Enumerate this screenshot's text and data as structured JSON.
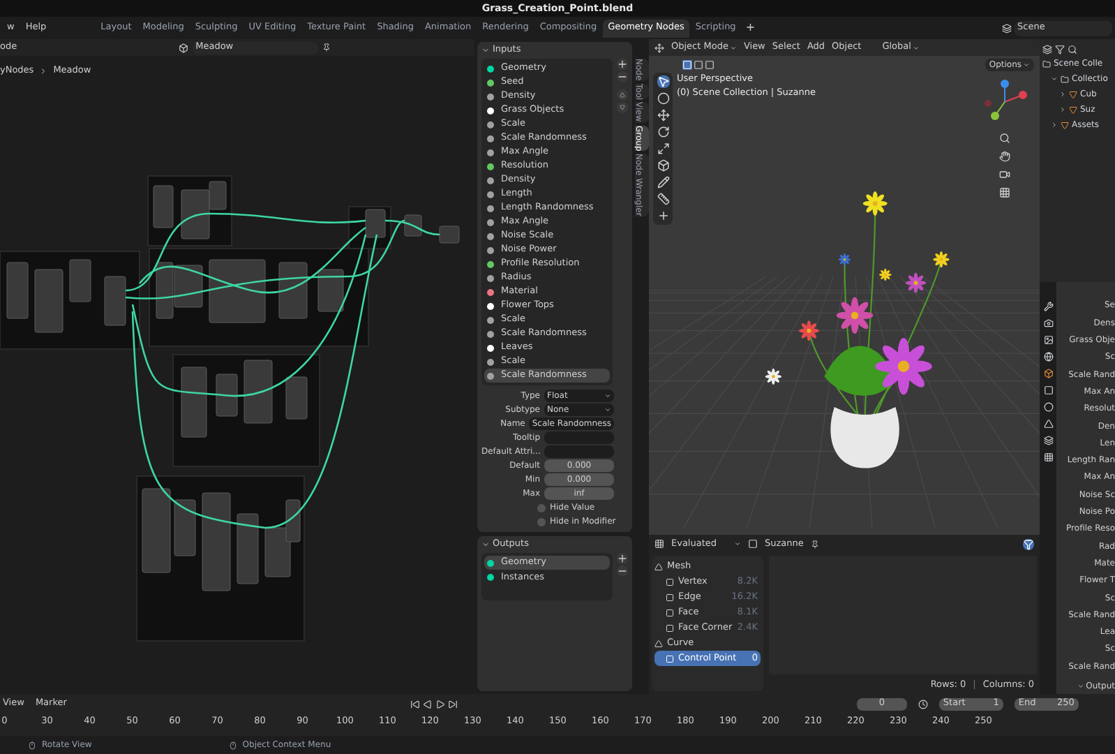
{
  "window": {
    "title": "Grass_Creation_Point.blend"
  },
  "menu": [
    "w",
    "Help"
  ],
  "workspace_tabs": [
    {
      "label": "Layout",
      "selected": false
    },
    {
      "label": "Modeling",
      "selected": false
    },
    {
      "label": "Sculpting",
      "selected": false
    },
    {
      "label": "UV Editing",
      "selected": false
    },
    {
      "label": "Texture Paint",
      "selected": false
    },
    {
      "label": "Shading",
      "selected": false
    },
    {
      "label": "Animation",
      "selected": false
    },
    {
      "label": "Rendering",
      "selected": false
    },
    {
      "label": "Compositing",
      "selected": false
    },
    {
      "label": "Geometry Nodes",
      "selected": true
    },
    {
      "label": "Scripting",
      "selected": false
    }
  ],
  "add_workspace": "+",
  "scene": {
    "value": "Scene"
  },
  "node_editor": {
    "editor_label": "ode",
    "node_group": "Meadow",
    "breadcrumb": [
      "yNodes",
      "Meadow"
    ]
  },
  "side_tabs": [
    {
      "label": "Node",
      "selected": false
    },
    {
      "label": "Tool",
      "selected": false
    },
    {
      "label": "View",
      "selected": false
    },
    {
      "label": "Group",
      "selected": true
    },
    {
      "label": "Node Wrangler",
      "selected": false
    }
  ],
  "group_inputs": {
    "title": "Inputs",
    "items": [
      {
        "name": "Geometry",
        "color": "#00d6a3",
        "selected": false
      },
      {
        "name": "Seed",
        "color": "#63c763",
        "selected": false
      },
      {
        "name": "Density",
        "color": "#a1a1a1",
        "selected": false
      },
      {
        "name": "Grass Objects",
        "color": "#ffffff",
        "selected": false
      },
      {
        "name": "Scale",
        "color": "#a1a1a1",
        "selected": false
      },
      {
        "name": "Scale Randomness",
        "color": "#a1a1a1",
        "selected": false
      },
      {
        "name": "Max Angle",
        "color": "#a1a1a1",
        "selected": false
      },
      {
        "name": "Resolution",
        "color": "#63c763",
        "selected": false
      },
      {
        "name": "Density",
        "color": "#a1a1a1",
        "selected": false
      },
      {
        "name": "Length",
        "color": "#a1a1a1",
        "selected": false
      },
      {
        "name": "Length Randomness",
        "color": "#a1a1a1",
        "selected": false
      },
      {
        "name": "Max Angle",
        "color": "#a1a1a1",
        "selected": false
      },
      {
        "name": "Noise Scale",
        "color": "#a1a1a1",
        "selected": false
      },
      {
        "name": "Noise Power",
        "color": "#a1a1a1",
        "selected": false
      },
      {
        "name": "Profile Resolution",
        "color": "#63c763",
        "selected": false
      },
      {
        "name": "Radius",
        "color": "#a1a1a1",
        "selected": false
      },
      {
        "name": "Material",
        "color": "#eb7582",
        "selected": false
      },
      {
        "name": "Flower Tops",
        "color": "#ffffff",
        "selected": false
      },
      {
        "name": "Scale",
        "color": "#a1a1a1",
        "selected": false
      },
      {
        "name": "Scale Randomness",
        "color": "#a1a1a1",
        "selected": false
      },
      {
        "name": "Leaves",
        "color": "#ffffff",
        "selected": false
      },
      {
        "name": "Scale",
        "color": "#a1a1a1",
        "selected": false
      },
      {
        "name": "Scale Randomness",
        "color": "#a1a1a1",
        "selected": true
      }
    ]
  },
  "socket_properties": [
    {
      "label": "Type",
      "value": "Float",
      "kind": "dropdown"
    },
    {
      "label": "Subtype",
      "value": "None",
      "kind": "dropdown"
    },
    {
      "label": "Name",
      "value": "Scale Randomness",
      "kind": "text"
    },
    {
      "label": "Tooltip",
      "kind": "text"
    },
    {
      "label": "Default Attri...",
      "kind": "text"
    },
    {
      "label": "Default",
      "value": "0.000",
      "kind": "number"
    },
    {
      "label": "Min",
      "value": "0.000",
      "kind": "number"
    },
    {
      "label": "Max",
      "value": "inf",
      "kind": "number"
    }
  ],
  "options": [
    {
      "label": "Hide Value",
      "checked": false
    },
    {
      "label": "Hide in Modifier",
      "checked": false
    }
  ],
  "group_outputs": {
    "title": "Outputs",
    "items": [
      {
        "name": "Geometry",
        "color": "#00d6a3",
        "selected": true
      },
      {
        "name": "Instances",
        "color": "#00d6a3",
        "selected": false
      }
    ]
  },
  "viewport": {
    "mode": "Object Mode",
    "menu": [
      "View",
      "Select",
      "Add",
      "Object"
    ],
    "orientation": "Global",
    "options": "Options",
    "view_name": "User Perspective",
    "view_info": "(0) Scene Collection | Suzanne"
  },
  "spreadsheet": {
    "mode": "Evaluated",
    "object": "Suzanne",
    "domains": [
      {
        "label": "Mesh",
        "kind": "group"
      },
      {
        "label": "Vertex",
        "count": "8.2K",
        "kind": "domain",
        "selected": false
      },
      {
        "label": "Edge",
        "count": "16.2K",
        "kind": "domain",
        "selected": false
      },
      {
        "label": "Face",
        "count": "8.1K",
        "kind": "domain",
        "selected": false
      },
      {
        "label": "Face Corner",
        "count": "2.4K",
        "kind": "domain",
        "selected": false
      },
      {
        "label": "Curve",
        "kind": "group"
      },
      {
        "label": "Control Point",
        "count": "0",
        "kind": "domain",
        "selected": true
      }
    ],
    "rows": "Rows: 0",
    "separator": "|",
    "columns": "Columns: 0"
  },
  "outliner": {
    "items": [
      {
        "label": "Scene Colle",
        "children": [
          {
            "label": "Collectio",
            "expanded": true,
            "children": [
              {
                "label": "Cub",
                "expanded": false
              },
              {
                "label": "Suz",
                "expanded": false
              }
            ]
          },
          {
            "label": "Assets",
            "expanded": false
          }
        ]
      }
    ]
  },
  "properties": {
    "fields": [
      "Se",
      "Dens",
      "Grass Obje",
      "Sc",
      "Scale Rand",
      "Max An",
      "Resolut",
      "Den",
      "Len",
      "Length Ran",
      "Max An",
      "Noise Sc",
      "Noise Po",
      "Profile Reso",
      "Rad",
      "Mate",
      "Flower T",
      "Sc",
      "Scale Rand",
      "Lea",
      "Sc",
      "Scale Rand"
    ],
    "section": "Output"
  },
  "timeline": {
    "menu": [
      "View",
      "Marker"
    ],
    "current_frame": "0",
    "start_label": "Start",
    "start": "1",
    "end_label": "End",
    "end": "250",
    "ruler": [
      "0",
      "30",
      "40",
      "50",
      "60",
      "70",
      "80",
      "90",
      "100",
      "110",
      "120",
      "130",
      "140",
      "150",
      "160",
      "170",
      "180",
      "190",
      "200",
      "210",
      "220",
      "230",
      "240",
      "250"
    ]
  },
  "status_bar": [
    "Rotate View",
    "Object Context Menu"
  ]
}
